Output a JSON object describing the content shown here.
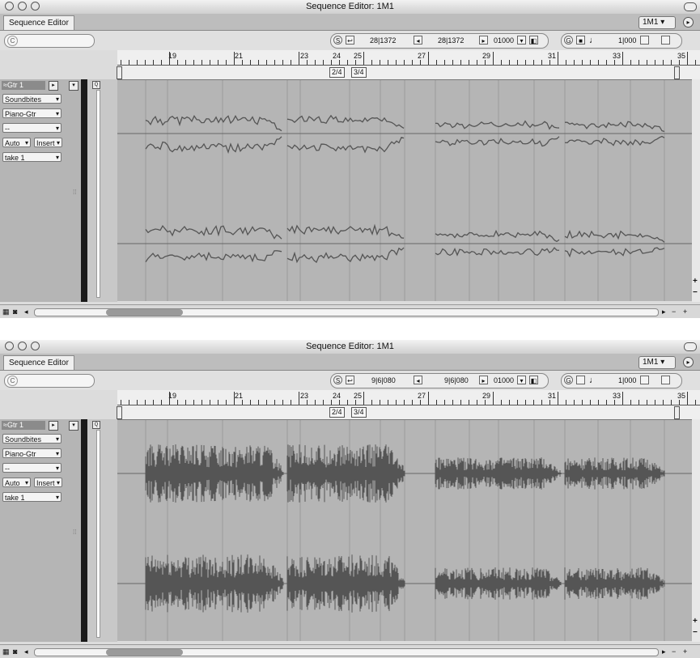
{
  "windows": [
    {
      "title": "Sequence Editor: 1M1",
      "tab": "Sequence Editor",
      "sequence_selector": "1M1",
      "playhead_position": "28|1372",
      "playhead_position_2": "28|1372",
      "nudge_value": "01000",
      "snap_value": "1|000",
      "ruler_bars": [
        "19",
        "21",
        "23",
        "24",
        "25",
        "27",
        "29",
        "31",
        "33",
        "35"
      ],
      "time_signatures": [
        "2/4",
        "3/4"
      ],
      "track": {
        "name": "Gtr 1",
        "soundbites": "Soundbites",
        "instrument": "Piano-Gtr",
        "dash": "--",
        "auto": "Auto",
        "insert": "Insert",
        "take": "take 1"
      },
      "waveform_style": "outline"
    },
    {
      "title": "Sequence Editor: 1M1",
      "tab": "Sequence Editor",
      "sequence_selector": "1M1",
      "playhead_position": "9|6|080",
      "playhead_position_2": "9|6|080",
      "nudge_value": "01000",
      "snap_value": "1|000",
      "ruler_bars": [
        "19",
        "21",
        "23",
        "24",
        "25",
        "27",
        "29",
        "31",
        "33",
        "35"
      ],
      "time_signatures": [
        "2/4",
        "3/4"
      ],
      "track": {
        "name": "Gtr 1",
        "soundbites": "Soundbites",
        "instrument": "Piano-Gtr",
        "dash": "--",
        "auto": "Auto",
        "insert": "Insert",
        "take": "take 1"
      },
      "waveform_style": "filled"
    }
  ],
  "icons": {
    "s_button": "S",
    "g_button": "G",
    "note": "♩",
    "plus": "+",
    "minus": "−"
  }
}
